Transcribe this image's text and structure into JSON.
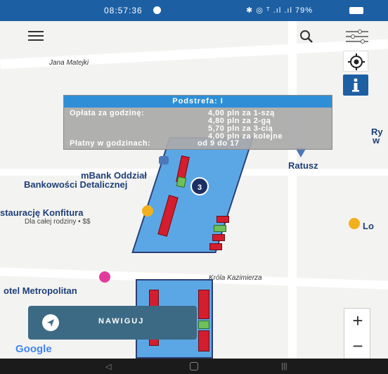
{
  "status_bar": {
    "time": "08:57:36",
    "right_text": "✱ ◎ ᵀ .ıl .ıl 79%"
  },
  "toolbar": {
    "menu": "menu",
    "search": "search",
    "filters": "filters"
  },
  "popup": {
    "title": "Podstrefa: I",
    "fee_label": "Opłata za godzinę:",
    "fees": [
      "4,00 pln za 1-szą",
      "4,80 pln za 2-gą",
      "5,70 pln za 3-cią",
      "4,00 pln za kolejne"
    ],
    "hours_label": "Płatny w godzinach:",
    "hours_value": "od 9 do 17"
  },
  "map": {
    "streets": {
      "jana_matejki": "Jana Matejki",
      "krola_kazimierza": "Króla Kazimierza"
    },
    "pois": {
      "mbank_line1": "mBank Oddział",
      "mbank_line2": "Bankowości Detalicznej",
      "ratusz": "Ratusz",
      "restaurant": "staurację Konfitura",
      "restaurant_sub": "Dla całej rodziny • $$",
      "hotel": "otel Metropolitan",
      "right_edge_1": "Ry",
      "right_edge_2": "w",
      "lo": "Lo"
    },
    "marker_count": "3"
  },
  "navigate": {
    "label": "NAWIGUJ"
  },
  "google_logo": "Google",
  "colors": {
    "status_bar": "#1d5fa3",
    "zone_fill": "#5ba7e6",
    "zone_border": "#2d3f73",
    "occupied": "#d41d2d",
    "free": "#6fbf5b",
    "popup_header": "#2f8fd6",
    "navigate_button": "#3c6a84"
  }
}
